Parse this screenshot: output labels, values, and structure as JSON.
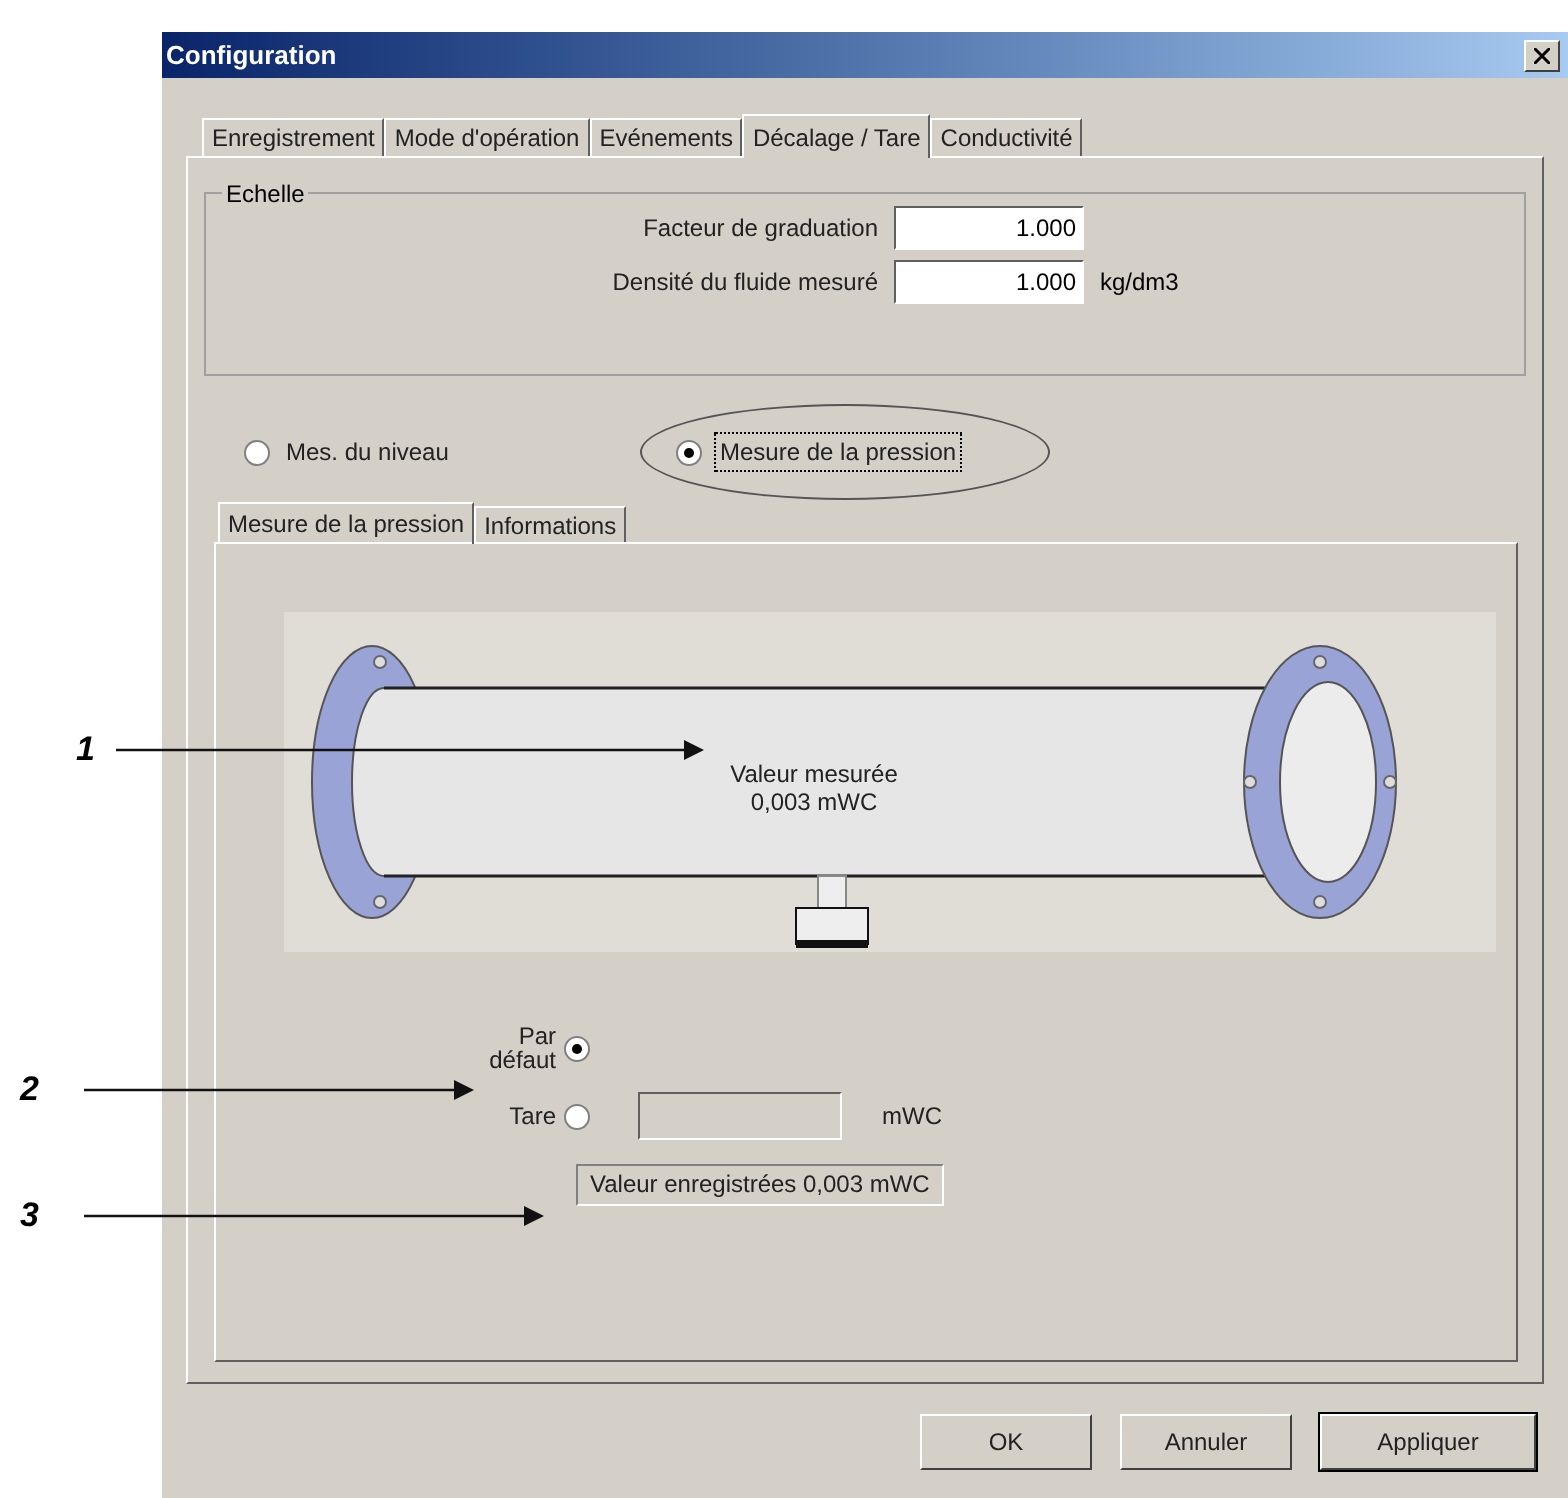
{
  "window": {
    "title": "Configuration"
  },
  "tabs": [
    {
      "label": "Enregistrement",
      "selected": false
    },
    {
      "label": "Mode d'opération",
      "selected": false
    },
    {
      "label": "Evénements",
      "selected": false
    },
    {
      "label": "Décalage / Tare",
      "selected": true
    },
    {
      "label": "Conductivité",
      "selected": false
    }
  ],
  "scale_group": {
    "title": "Echelle",
    "fields": [
      {
        "label": "Facteur de graduation",
        "value": "1.000"
      },
      {
        "label": "Densité du fluide mesuré",
        "value": "1.000",
        "unit": "kg/dm3"
      }
    ]
  },
  "mode_options": [
    {
      "label": "Mes. du niveau",
      "selected": false,
      "circled": false
    },
    {
      "label": "Mesure de la pression",
      "selected": true,
      "circled": true
    }
  ],
  "subtabs": [
    {
      "label": "Mesure de la pression",
      "selected": true
    },
    {
      "label": "Informations",
      "selected": false
    }
  ],
  "diagram": {
    "reading_label": "Valeur mesurée",
    "reading_value": "0,003 mWC"
  },
  "offset_options": [
    {
      "label": "Par défaut",
      "selected": true,
      "kind": "plain"
    },
    {
      "label": "Tare",
      "selected": false,
      "kind": "field",
      "unit": "mWC"
    }
  ],
  "recorded_value": "Valeur enregistrées 0,003 mWC",
  "buttons": [
    {
      "label": "OK",
      "default": false
    },
    {
      "label": "Annuler",
      "default": false
    },
    {
      "label": "Appliquer",
      "default": true
    }
  ],
  "callouts": [
    {
      "number": "1"
    },
    {
      "number": "2"
    },
    {
      "number": "3"
    }
  ]
}
